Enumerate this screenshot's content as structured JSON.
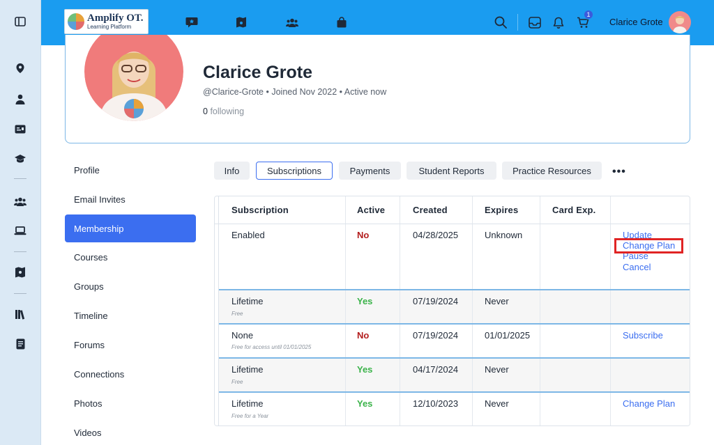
{
  "header": {
    "logo_title": "Amplify OT.",
    "logo_subtitle": "Learning Platform",
    "username": "Clarice Grote",
    "cart_count": "1"
  },
  "profile": {
    "name": "Clarice Grote",
    "meta": "@Clarice-Grote • Joined Nov 2022 • Active now",
    "following_count": "0",
    "following_label": "following"
  },
  "sidemenu": {
    "items": [
      {
        "label": "Profile"
      },
      {
        "label": "Email Invites"
      },
      {
        "label": "Membership"
      },
      {
        "label": "Courses"
      },
      {
        "label": "Groups"
      },
      {
        "label": "Timeline"
      },
      {
        "label": "Forums"
      },
      {
        "label": "Connections"
      },
      {
        "label": "Photos"
      },
      {
        "label": "Videos"
      }
    ],
    "active": "Membership"
  },
  "tabs": [
    {
      "label": "Info"
    },
    {
      "label": "Subscriptions"
    },
    {
      "label": "Payments"
    },
    {
      "label": "Student Reports"
    },
    {
      "label": "Practice Resources"
    }
  ],
  "more_label": "•••",
  "table": {
    "headers": [
      "Subscription",
      "Active",
      "Created",
      "Expires",
      "Card Exp."
    ],
    "rows": [
      {
        "subscription": "Enabled",
        "subnote": "",
        "active": "No",
        "created": "04/28/2025",
        "expires": "Unknown",
        "card_exp": "",
        "actions": [
          "Update",
          "Change Plan",
          "Pause",
          "Cancel"
        ]
      },
      {
        "subscription": "Lifetime",
        "subnote": "Free",
        "active": "Yes",
        "created": "07/19/2024",
        "expires": "Never",
        "card_exp": "",
        "actions": []
      },
      {
        "subscription": "None",
        "subnote": "Free for access until 01/01/2025",
        "active": "No",
        "created": "07/19/2024",
        "expires": "01/01/2025",
        "card_exp": "",
        "actions": [
          "Subscribe"
        ]
      },
      {
        "subscription": "Lifetime",
        "subnote": "Free",
        "active": "Yes",
        "created": "04/17/2024",
        "expires": "Never",
        "card_exp": "",
        "actions": []
      },
      {
        "subscription": "Lifetime",
        "subnote": "Free for a Year",
        "active": "Yes",
        "created": "12/10/2023",
        "expires": "Never",
        "card_exp": "",
        "actions": [
          "Change Plan"
        ]
      }
    ]
  },
  "colors": {
    "topbar": "#1a9cf0",
    "accent": "#3b6ef0",
    "yes": "#3bb34a",
    "no": "#b31d1d",
    "highlight": "#e02424"
  }
}
